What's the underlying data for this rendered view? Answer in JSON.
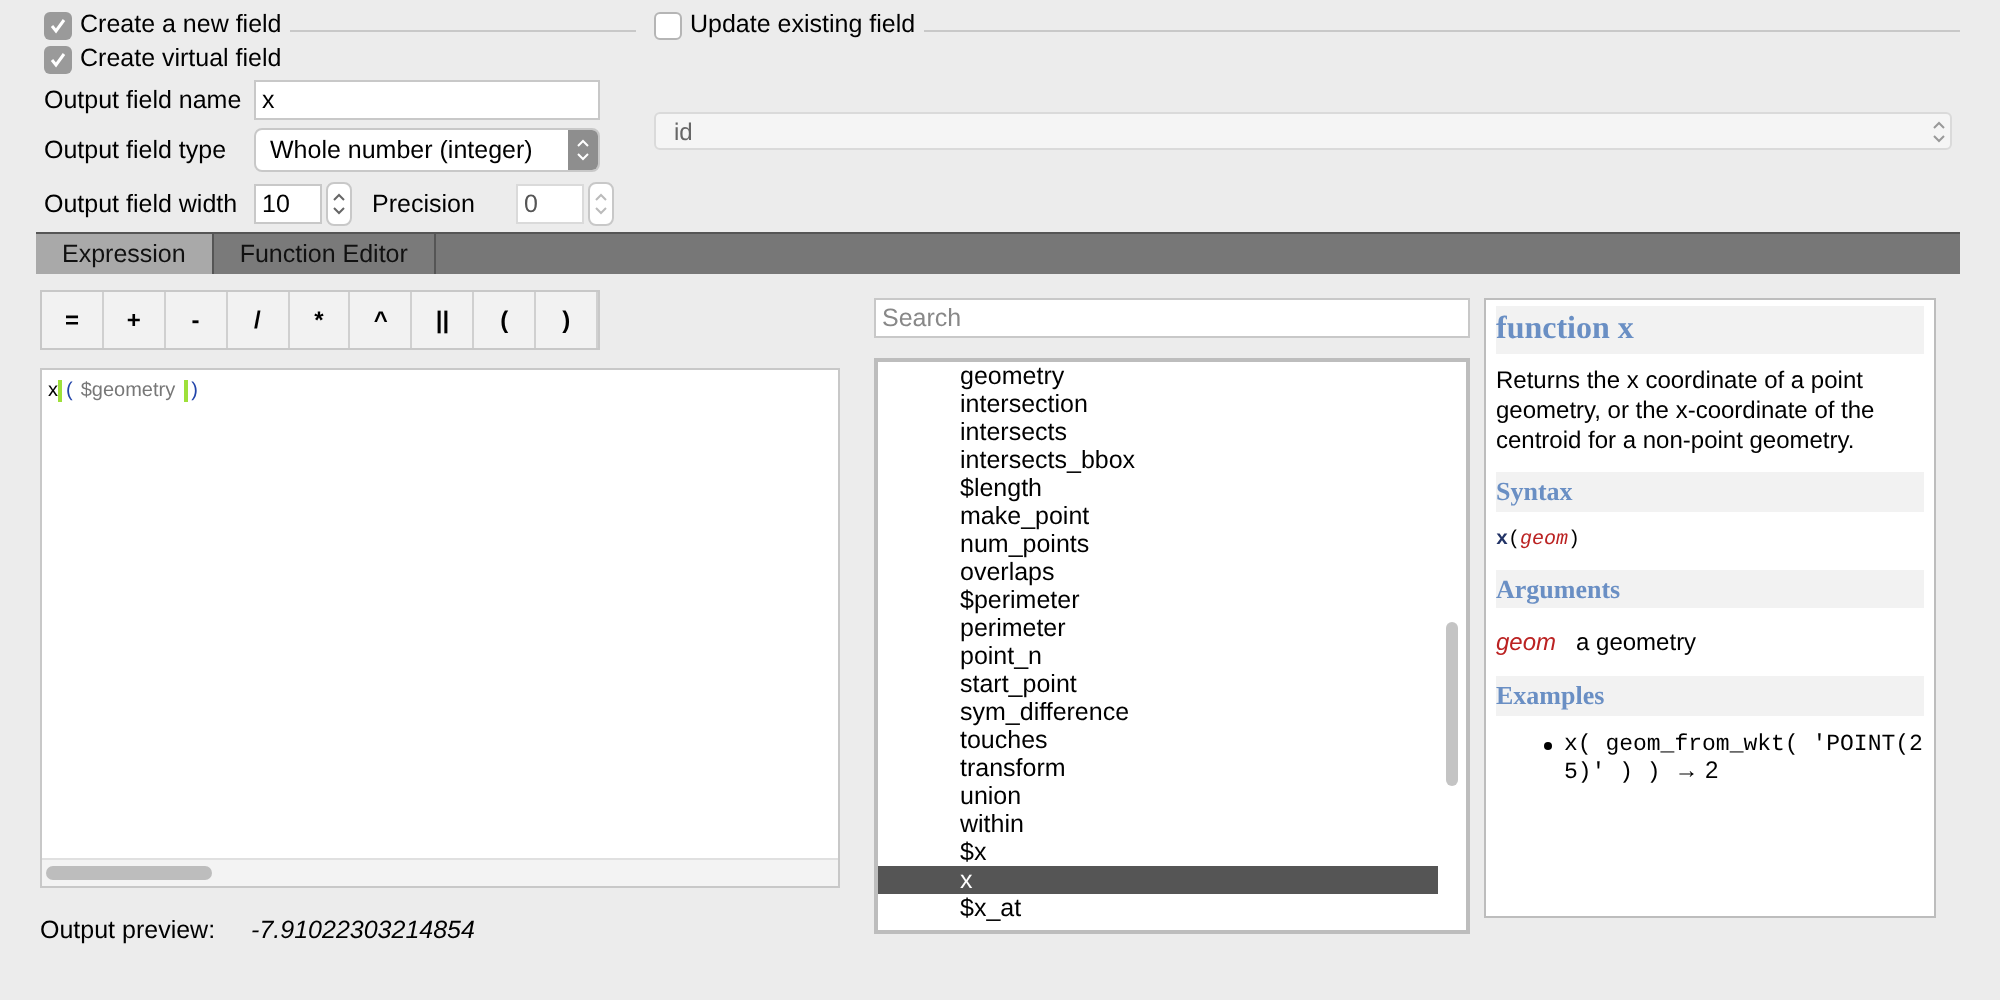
{
  "new_field": {
    "label": "Create a new field",
    "checked": true
  },
  "virtual_field": {
    "label": "Create virtual field",
    "checked": true
  },
  "update_field": {
    "label": "Update existing field",
    "checked": false
  },
  "output_name": {
    "label": "Output field name",
    "value": "x"
  },
  "output_type": {
    "label": "Output field type",
    "value": "Whole number (integer)"
  },
  "output_width": {
    "label": "Output field width",
    "value": "10"
  },
  "precision": {
    "label": "Precision",
    "value": "0"
  },
  "existing_field": {
    "value": "id"
  },
  "tabs": [
    {
      "label": "Expression",
      "selected": true
    },
    {
      "label": "Function Editor",
      "selected": false
    }
  ],
  "operators": [
    "=",
    "+",
    "-",
    "/",
    "*",
    "^",
    "||",
    "(",
    ")"
  ],
  "expression": [
    {
      "text": "x",
      "kind": "function"
    },
    {
      "text": "(",
      "kind": "bracket"
    },
    {
      "text": "$geometry",
      "kind": "variable"
    },
    {
      "text": ")",
      "kind": "bracket"
    }
  ],
  "output_preview": {
    "label": "Output preview:",
    "value": "-7.91022303214854"
  },
  "search": {
    "placeholder": "Search"
  },
  "functions": [
    {
      "label": "geometry",
      "selected": false
    },
    {
      "label": "intersection",
      "selected": false
    },
    {
      "label": "intersects",
      "selected": false
    },
    {
      "label": "intersects_bbox",
      "selected": false
    },
    {
      "label": "$length",
      "selected": false
    },
    {
      "label": "make_point",
      "selected": false
    },
    {
      "label": "num_points",
      "selected": false
    },
    {
      "label": "overlaps",
      "selected": false
    },
    {
      "label": "$perimeter",
      "selected": false
    },
    {
      "label": "perimeter",
      "selected": false
    },
    {
      "label": "point_n",
      "selected": false
    },
    {
      "label": "start_point",
      "selected": false
    },
    {
      "label": "sym_difference",
      "selected": false
    },
    {
      "label": "touches",
      "selected": false
    },
    {
      "label": "transform",
      "selected": false
    },
    {
      "label": "union",
      "selected": false
    },
    {
      "label": "within",
      "selected": false
    },
    {
      "label": "$x",
      "selected": false
    },
    {
      "label": "x",
      "selected": true
    },
    {
      "label": "$x_at",
      "selected": false
    }
  ],
  "help": {
    "title": "function x",
    "description": "Returns the x coordinate of a point geometry, or the x-coordinate of the centroid for a non-point geometry.",
    "syntax_heading": "Syntax",
    "syntax_function": "x",
    "syntax_open": "(",
    "syntax_argument": "geom",
    "syntax_close": ")",
    "arguments_heading": "Arguments",
    "arguments": [
      {
        "name": "geom",
        "description": "a geometry"
      }
    ],
    "examples_heading": "Examples",
    "examples": [
      {
        "code": "x( geom_from_wkt( 'POINT(2 5)' ) )",
        "result": "→ 2"
      }
    ]
  }
}
